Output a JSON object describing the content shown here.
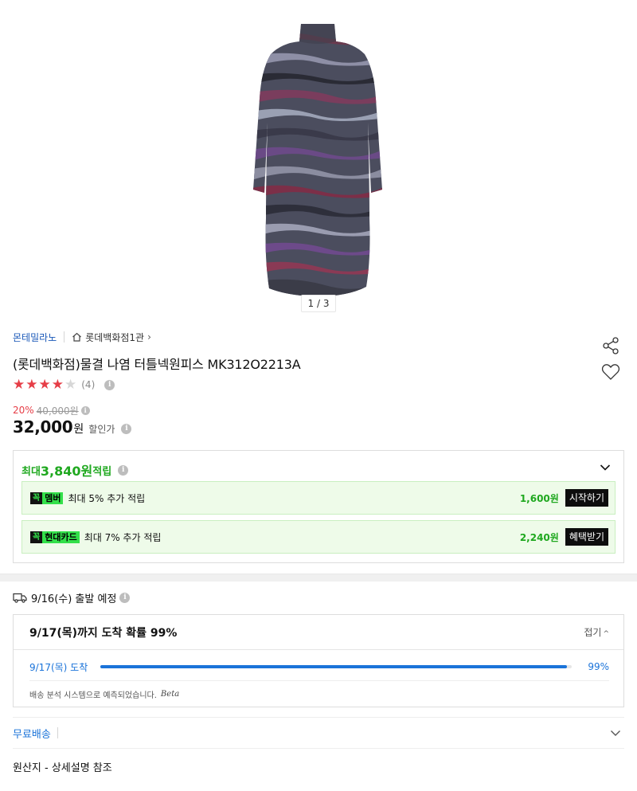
{
  "gallery": {
    "pager": "1 / 3"
  },
  "brand": {
    "name": "몬테밀라노",
    "store": "롯데백화점1관"
  },
  "product": {
    "title": "(롯데백화점)물결 나염 터틀넥원피스 MK312O2213A"
  },
  "rating": {
    "stars": 4,
    "max": 5,
    "count": "(4)"
  },
  "price": {
    "discount_pct": "20%",
    "original": "40,000원",
    "sale": "32,000",
    "won": "원",
    "sale_label": "할인가"
  },
  "points": {
    "prefix": "최대 ",
    "amount": "3,840원",
    "suffix": " 적립",
    "benefits": [
      {
        "tag_k": "꼭",
        "tag": "멤버",
        "desc": "최대 5% 추가 적립",
        "amount": "1,600원",
        "button": "시작하기"
      },
      {
        "tag_k": "꼭",
        "tag": "현대카드",
        "desc": "최대 7% 추가 적립",
        "amount": "2,240원",
        "button": "혜택받기"
      }
    ]
  },
  "shipping": {
    "depart": "9/16(수) 출발 예정",
    "eta_title": "9/17(목)까지 도착 확률 99%",
    "fold": "접기",
    "eta_date": "9/17(목) 도착",
    "eta_pct": "99%",
    "eta_fraction": 0.99,
    "note": "배송 분석 시스템으로 예측되었습니다.",
    "beta": "Beta",
    "free": "무료배송"
  },
  "origin": "원산지 - 상세설명 참조",
  "colors": {
    "accent_green": "#1fa81f",
    "tag_green": "#33e04a",
    "link_blue": "#1a73d9",
    "sale_red": "#e63e47"
  }
}
